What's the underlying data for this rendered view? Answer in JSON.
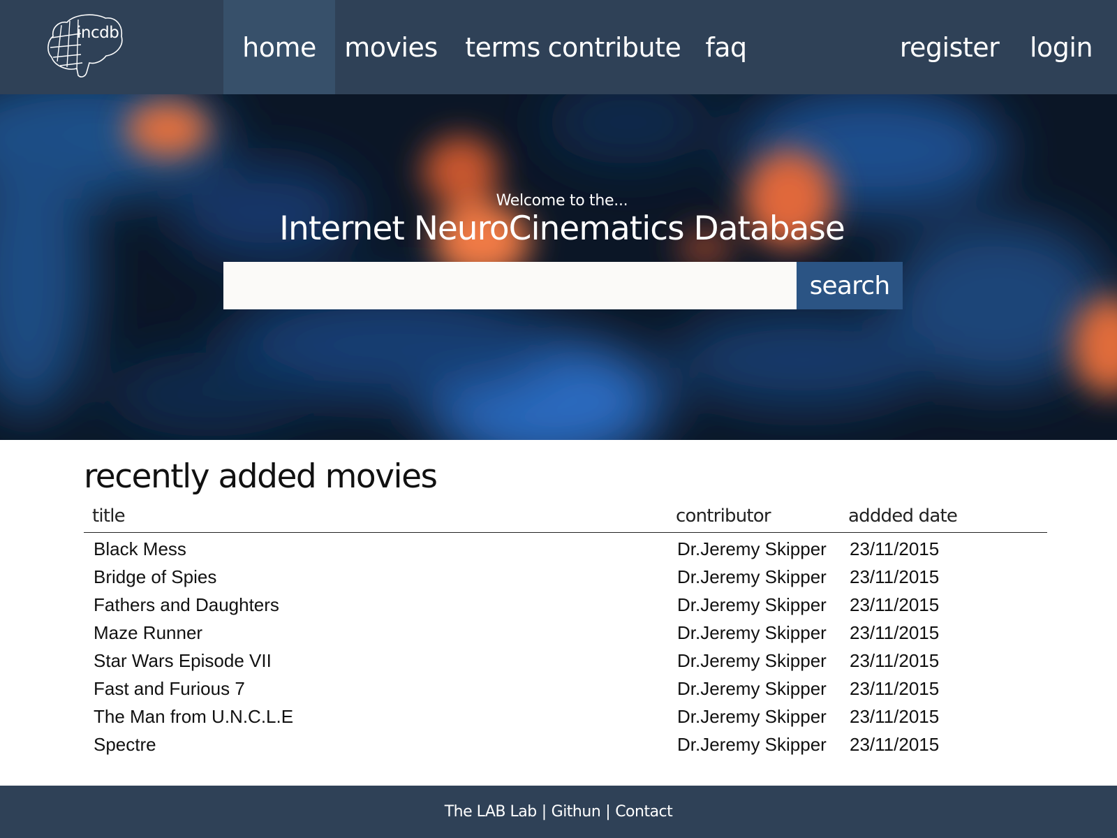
{
  "brand": {
    "logo_text": "incdb"
  },
  "nav": {
    "home": "home",
    "movies": "movies",
    "terms": "terms",
    "contribute": "contribute",
    "faq": "faq",
    "register": "register",
    "login": "login",
    "active": "home"
  },
  "hero": {
    "welcome": "Welcome to the...",
    "title": "Internet NeuroCinematics Database",
    "search_value": "",
    "search_button": "search"
  },
  "recent": {
    "heading": "recently added movies",
    "columns": {
      "title": "title",
      "contributor": "contributor",
      "date": "addded date"
    },
    "rows": [
      {
        "title": "Black Mess",
        "contributor": "Dr.Jeremy Skipper",
        "date": "23/11/2015"
      },
      {
        "title": "Bridge of Spies",
        "contributor": "Dr.Jeremy Skipper",
        "date": "23/11/2015"
      },
      {
        "title": "Fathers and Daughters",
        "contributor": "Dr.Jeremy Skipper",
        "date": "23/11/2015"
      },
      {
        "title": "Maze Runner",
        "contributor": "Dr.Jeremy Skipper",
        "date": "23/11/2015"
      },
      {
        "title": "Star Wars Episode VII",
        "contributor": "Dr.Jeremy Skipper",
        "date": "23/11/2015"
      },
      {
        "title": "Fast and Furious 7",
        "contributor": "Dr.Jeremy Skipper",
        "date": "23/11/2015"
      },
      {
        "title": "The Man from U.N.C.L.E",
        "contributor": "Dr.Jeremy Skipper",
        "date": "23/11/2015"
      },
      {
        "title": "Spectre",
        "contributor": "Dr.Jeremy Skipper",
        "date": "23/11/2015"
      }
    ]
  },
  "footer": {
    "lab": "The LAB Lab",
    "github": "Githun",
    "contact": "Contact",
    "separator": "|"
  },
  "colors": {
    "nav_bg": "#2f4157",
    "nav_active": "#37506a",
    "search_button": "#2b5484",
    "footer_bg": "#2f4157"
  }
}
